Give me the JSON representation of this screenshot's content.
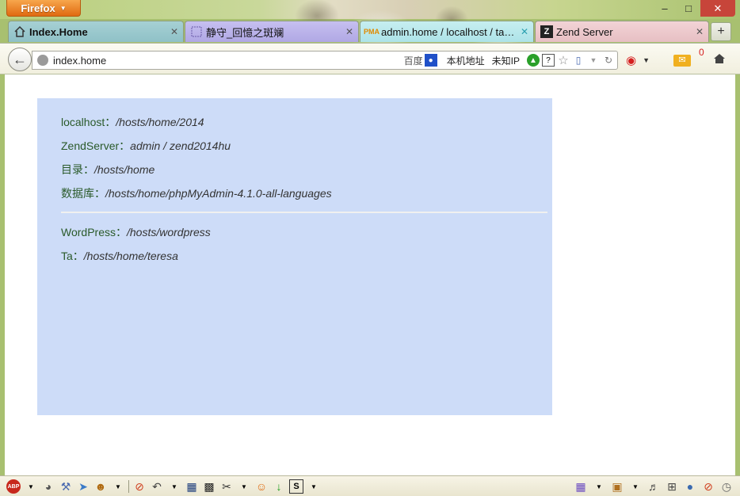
{
  "window": {
    "app_button": "Firefox",
    "controls": [
      "minimize",
      "maximize",
      "close"
    ]
  },
  "tabs": [
    {
      "label": "Index.Home",
      "icon": "home-icon",
      "active": true
    },
    {
      "label": "静守_回憶之斑斓",
      "icon": "page-icon",
      "active": false
    },
    {
      "label": "admin.home / localhost / ta /...",
      "icon": "phpmyadmin-icon",
      "active": false
    },
    {
      "label": "Zend Server",
      "icon": "zend-icon",
      "active": false
    }
  ],
  "navbar": {
    "url": "index.home",
    "search_engine": "百度",
    "ext_local_address": "本机地址",
    "ext_unknown_ip": "未知IP",
    "mail_count": "0"
  },
  "content": {
    "entries_group1": [
      {
        "key": "localhost：",
        "value": "/hosts/home/2014"
      },
      {
        "key": "ZendServer：",
        "value": "admin / zend2014hu"
      },
      {
        "key": "目录：",
        "value": "/hosts/home"
      },
      {
        "key": "数据库：",
        "value": "/hosts/home/phpMyAdmin-4.1.0-all-languages"
      }
    ],
    "entries_group2": [
      {
        "key": "WordPress：",
        "value": "/hosts/wordpress"
      },
      {
        "key": "Ta：",
        "value": "/hosts/home/teresa"
      }
    ]
  },
  "colors": {
    "panel_bg": "#cddcf8",
    "firefox_orange": "#e06a10",
    "frame_green": "#a8c070"
  }
}
